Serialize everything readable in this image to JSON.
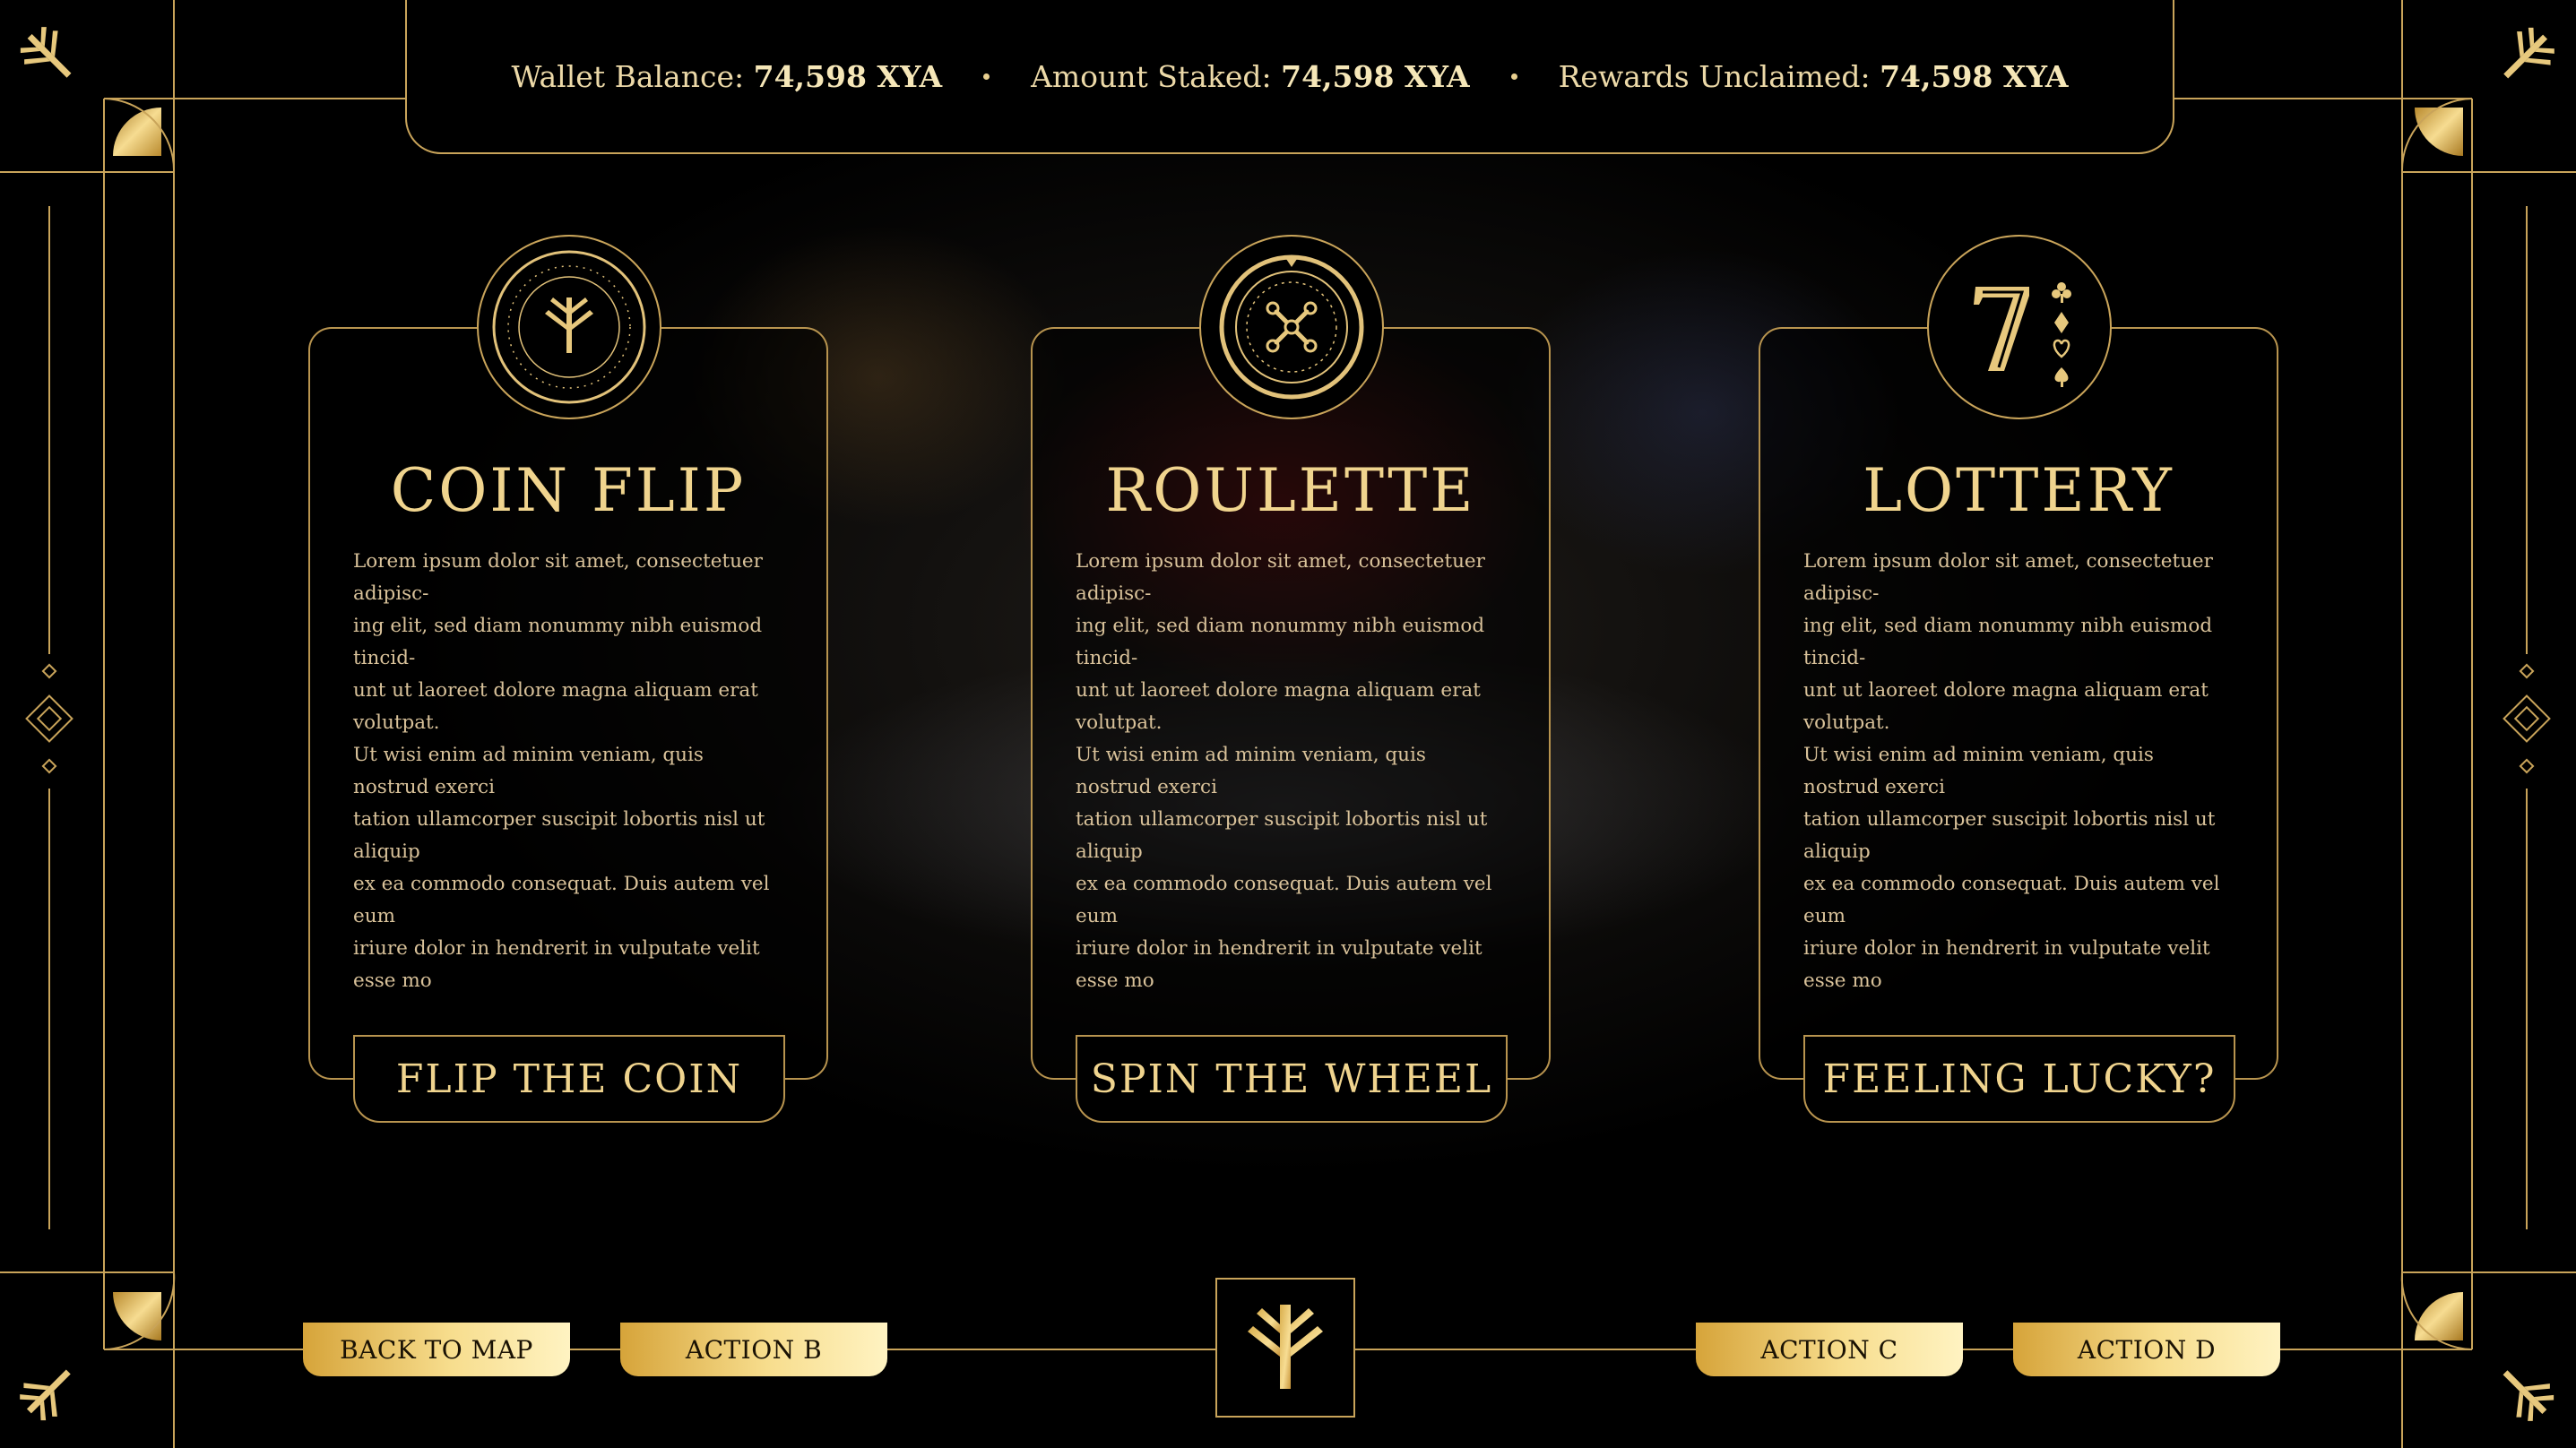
{
  "header": {
    "stats": [
      {
        "label": "Wallet Balance:",
        "value": "74,598 XYA"
      },
      {
        "label": "Amount Staked:",
        "value": "74,598 XYA"
      },
      {
        "label": "Rewards Unclaimed:",
        "value": "74,598 XYA"
      }
    ],
    "separator": "•"
  },
  "games": [
    {
      "title": "COIN FLIP",
      "icon": "coin-icon",
      "description": "Lorem ipsum dolor sit amet, consectetuer adipisc-\ning elit, sed diam nonummy nibh euismod tincid-\nunt ut laoreet dolore magna aliquam erat volutpat.\nUt wisi enim ad minim veniam, quis nostrud exerci\ntation ullamcorper suscipit lobortis nisl ut aliquip\nex ea commodo consequat. Duis autem vel eum\niriure dolor in hendrerit in vulputate velit esse mo",
      "button": "FLIP THE COIN"
    },
    {
      "title": "ROULETTE",
      "icon": "roulette-wheel-icon",
      "description": "Lorem ipsum dolor sit amet, consectetuer adipisc-\ning elit, sed diam nonummy nibh euismod tincid-\nunt ut laoreet dolore magna aliquam erat volutpat.\nUt wisi enim ad minim veniam, quis nostrud exerci\ntation ullamcorper suscipit lobortis nisl ut aliquip\nex ea commodo consequat. Duis autem vel eum\niriure dolor in hendrerit in vulputate velit esse mo",
      "button": "SPIN THE WHEEL"
    },
    {
      "title": "LOTTERY",
      "icon": "lucky-seven-icon",
      "description": "Lorem ipsum dolor sit amet, consectetuer adipisc-\ning elit, sed diam nonummy nibh euismod tincid-\nunt ut laoreet dolore magna aliquam erat volutpat.\nUt wisi enim ad minim veniam, quis nostrud exerci\ntation ullamcorper suscipit lobortis nisl ut aliquip\nex ea commodo consequat. Duis autem vel eum\niriure dolor in hendrerit in vulputate velit esse mo",
      "button": "FEELING LUCKY?"
    }
  ],
  "footer": {
    "buttons": [
      "BACK TO MAP",
      "ACTION B",
      "ACTION C",
      "ACTION D"
    ],
    "logo_icon": "tree-logo-icon"
  },
  "colors": {
    "gold": "#c9a45a",
    "gold_light": "#f0d48e",
    "background": "#000000"
  }
}
